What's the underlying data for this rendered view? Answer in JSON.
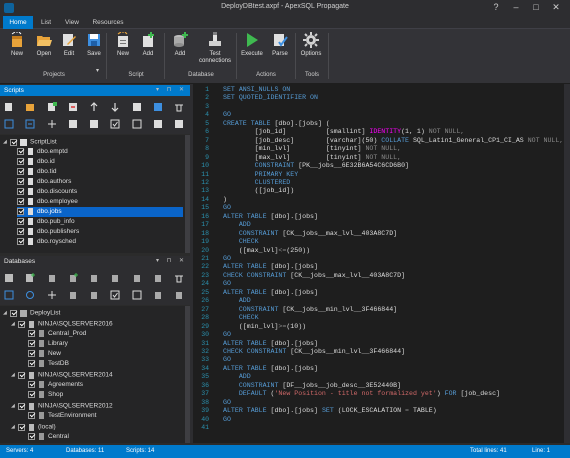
{
  "window": {
    "title": "DeployDBtest.axpf - ApexSQL Propagate"
  },
  "tabs": [
    "Home",
    "List",
    "View",
    "Resources"
  ],
  "ribbon": {
    "groups": [
      {
        "label": "Projects",
        "buttons": [
          "New",
          "Open",
          "Edit",
          "Save"
        ]
      },
      {
        "label": "Script",
        "buttons": [
          "New",
          "Add"
        ]
      },
      {
        "label": "Database",
        "buttons": [
          "Add",
          "Test connections"
        ]
      },
      {
        "label": "Actions",
        "buttons": [
          "Execute",
          "Parse"
        ]
      },
      {
        "label": "Tools",
        "buttons": [
          "Options"
        ]
      }
    ]
  },
  "scripts_panel": {
    "title": "Scripts",
    "root": "ScriptList",
    "items": [
      "dbo.emptd",
      "dbo.id",
      "dbo.tid",
      "dbo.authors",
      "dbo.discounts",
      "dbo.employee",
      "dbo.jobs",
      "dbo.pub_info",
      "dbo.publishers",
      "dbo.roysched"
    ],
    "selected": "dbo.jobs"
  },
  "databases_panel": {
    "title": "Databases",
    "root": "DeployList",
    "servers": [
      {
        "name": "NINJA\\SQLSERVER2016",
        "dbs": [
          "Central_Prod",
          "Library",
          "New",
          "TestDB"
        ]
      },
      {
        "name": "NINJA\\SQLSERVER2014",
        "dbs": [
          "Agreements",
          "Shop"
        ]
      },
      {
        "name": "NINJA\\SQLSERVER2012",
        "dbs": [
          "TestEnvironment"
        ]
      },
      {
        "name": "(local)",
        "dbs": [
          "Central"
        ]
      }
    ]
  },
  "editor": {
    "lines": [
      [
        [
          "k",
          "SET ANSI_NULLS ON"
        ]
      ],
      [
        [
          "k",
          "SET QUOTED_IDENTIFIER ON"
        ]
      ],
      [],
      [
        [
          "k",
          "GO"
        ]
      ],
      [
        [
          "k",
          "CREATE TABLE "
        ],
        [
          "t",
          "[dbo].[jobs] ("
        ]
      ],
      [
        [
          "t",
          "        [job_id]          [smallint] "
        ],
        [
          "f",
          "IDENTITY"
        ],
        [
          "t",
          "(1, 1) "
        ],
        [
          "g",
          "NOT NULL,"
        ]
      ],
      [
        [
          "t",
          "        [job_desc]        [varchar](50) "
        ],
        [
          "k",
          "COLLATE "
        ],
        [
          "t",
          "SQL_Latin1_General_CP1_CI_AS "
        ],
        [
          "g",
          "NOT NULL,"
        ]
      ],
      [
        [
          "t",
          "        [min_lvl]         [tinyint] "
        ],
        [
          "g",
          "NOT NULL,"
        ]
      ],
      [
        [
          "t",
          "        [max_lvl]         [tinyint] "
        ],
        [
          "g",
          "NOT NULL,"
        ]
      ],
      [
        [
          "t",
          "        "
        ],
        [
          "k",
          "CONSTRAINT "
        ],
        [
          "t",
          "[PK__jobs__6E32B6A54C6CD6B0]"
        ]
      ],
      [
        [
          "t",
          "        "
        ],
        [
          "k",
          "PRIMARY KEY"
        ]
      ],
      [
        [
          "t",
          "        "
        ],
        [
          "k",
          "CLUSTERED"
        ]
      ],
      [
        [
          "t",
          "        ([job_id])"
        ]
      ],
      [
        [
          "t",
          ")"
        ]
      ],
      [
        [
          "k",
          "GO"
        ]
      ],
      [
        [
          "k",
          "ALTER TABLE "
        ],
        [
          "t",
          "[dbo].[jobs]"
        ]
      ],
      [
        [
          "t",
          "    "
        ],
        [
          "k",
          "ADD"
        ]
      ],
      [
        [
          "t",
          "    "
        ],
        [
          "k",
          "CONSTRAINT "
        ],
        [
          "t",
          "[CK__jobs__max_lvl__403A8C7D]"
        ]
      ],
      [
        [
          "t",
          "    "
        ],
        [
          "k",
          "CHECK"
        ]
      ],
      [
        [
          "t",
          "    ([max_lvl]"
        ],
        [
          "g",
          "<="
        ],
        [
          "t",
          "(250))"
        ]
      ],
      [
        [
          "k",
          "GO"
        ]
      ],
      [
        [
          "k",
          "ALTER TABLE "
        ],
        [
          "t",
          "[dbo].[jobs]"
        ]
      ],
      [
        [
          "k",
          "CHECK CONSTRAINT "
        ],
        [
          "t",
          "[CK__jobs__max_lvl__403A8C7D]"
        ]
      ],
      [
        [
          "k",
          "GO"
        ]
      ],
      [
        [
          "k",
          "ALTER TABLE "
        ],
        [
          "t",
          "[dbo].[jobs]"
        ]
      ],
      [
        [
          "t",
          "    "
        ],
        [
          "k",
          "ADD"
        ]
      ],
      [
        [
          "t",
          "    "
        ],
        [
          "k",
          "CONSTRAINT "
        ],
        [
          "t",
          "[CK__jobs__min_lvl__3F466844]"
        ]
      ],
      [
        [
          "t",
          "    "
        ],
        [
          "k",
          "CHECK"
        ]
      ],
      [
        [
          "t",
          "    ([min_lvl]"
        ],
        [
          "g",
          ">="
        ],
        [
          "t",
          "(10))"
        ]
      ],
      [
        [
          "k",
          "GO"
        ]
      ],
      [
        [
          "k",
          "ALTER TABLE "
        ],
        [
          "t",
          "[dbo].[jobs]"
        ]
      ],
      [
        [
          "k",
          "CHECK CONSTRAINT "
        ],
        [
          "t",
          "[CK__jobs__min_lvl__3F466844]"
        ]
      ],
      [
        [
          "k",
          "GO"
        ]
      ],
      [
        [
          "k",
          "ALTER TABLE "
        ],
        [
          "t",
          "[dbo].[jobs]"
        ]
      ],
      [
        [
          "t",
          "    "
        ],
        [
          "k",
          "ADD"
        ]
      ],
      [
        [
          "t",
          "    "
        ],
        [
          "k",
          "CONSTRAINT "
        ],
        [
          "t",
          "[DF__jobs__job_desc__3E52440B]"
        ]
      ],
      [
        [
          "t",
          "    "
        ],
        [
          "k",
          "DEFAULT "
        ],
        [
          "t",
          "("
        ],
        [
          "s",
          "'New Position - title not formalized yet'"
        ],
        [
          "t",
          ") "
        ],
        [
          "k",
          "FOR "
        ],
        [
          "t",
          "[job_desc]"
        ]
      ],
      [
        [
          "k",
          "GO"
        ]
      ],
      [
        [
          "k",
          "ALTER TABLE "
        ],
        [
          "t",
          "[dbo].[jobs] "
        ],
        [
          "k",
          "SET "
        ],
        [
          "t",
          "(LOCK_ESCALATION "
        ],
        [
          "g",
          "="
        ],
        [
          "t",
          " TABLE)"
        ]
      ],
      [
        [
          "k",
          "GO"
        ]
      ],
      []
    ]
  },
  "status": {
    "servers": "Servers: 4",
    "databases": "Databases: 11",
    "scripts": "Scripts: 14",
    "total_lines": "Total lines: 41",
    "line": "Line: 1"
  }
}
